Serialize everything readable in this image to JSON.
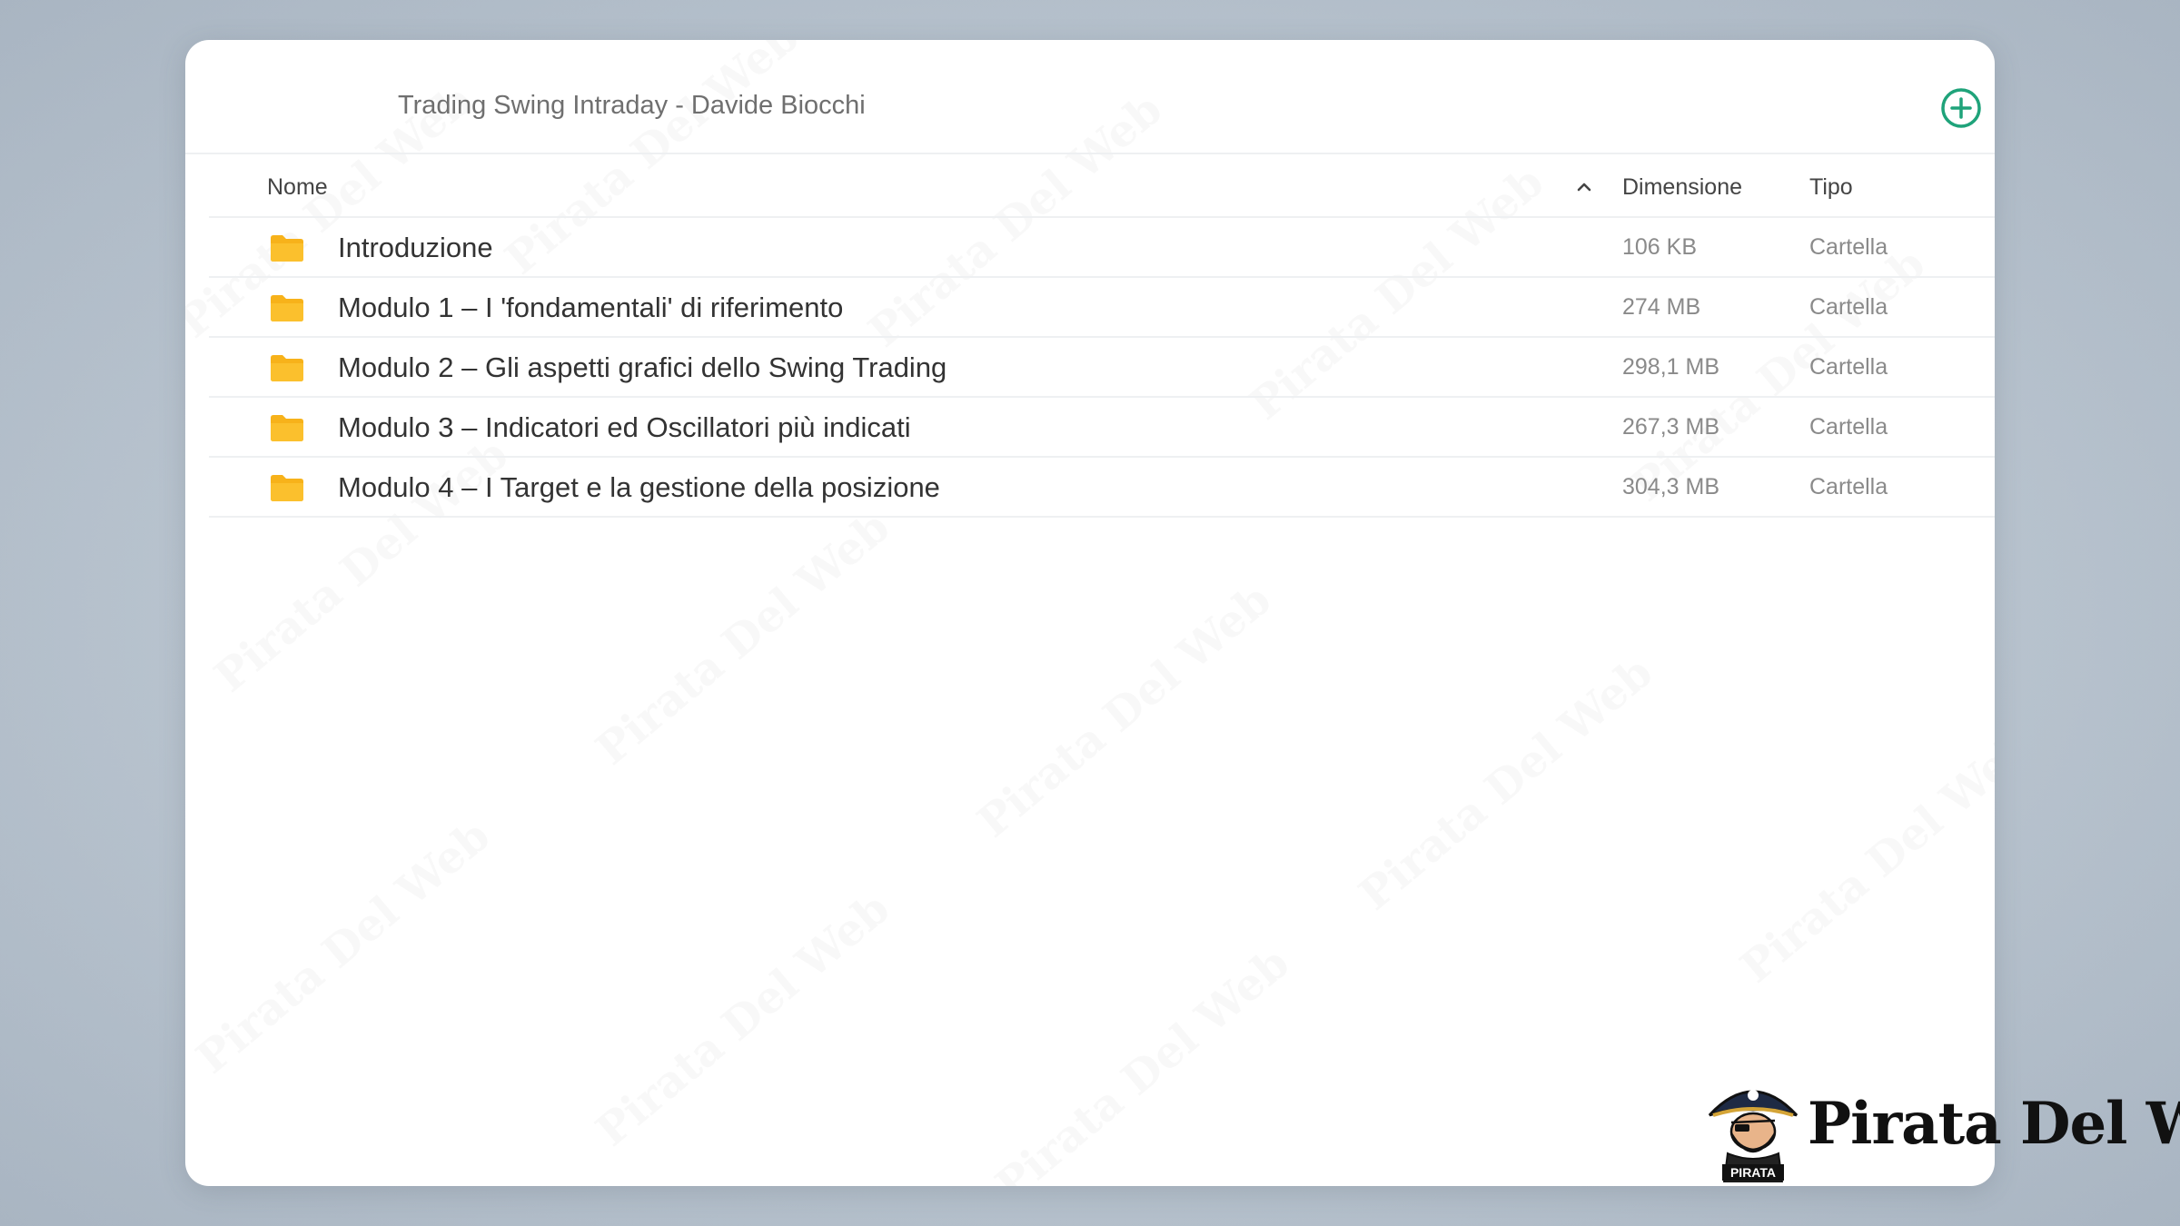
{
  "window": {
    "title": "Trading Swing Intraday - Davide Biocchi",
    "add_icon": "plus-circle-icon",
    "accent_color": "#1fa37a"
  },
  "columns": {
    "name": "Nome",
    "size": "Dimensione",
    "type": "Tipo",
    "sort_icon": "chevron-up-icon"
  },
  "rows": [
    {
      "name": "Introduzione",
      "size": "106 KB",
      "type": "Cartella"
    },
    {
      "name": "Modulo 1 – I 'fondamentali' di riferimento",
      "size": "274 MB",
      "type": "Cartella"
    },
    {
      "name": "Modulo 2 – Gli aspetti grafici dello Swing Trading",
      "size": "298,1 MB",
      "type": "Cartella"
    },
    {
      "name": "Modulo 3 – Indicatori ed Oscillatori più indicati",
      "size": "267,3 MB",
      "type": "Cartella"
    },
    {
      "name": "Modulo 4 – I Target e la gestione della posizione",
      "size": "304,3 MB",
      "type": "Cartella"
    }
  ],
  "folder_icon": "folder-icon",
  "folder_color": "#f7b21a",
  "watermark_text": "Pirata Del Web",
  "brand": {
    "name": "Pirata Del Web",
    "badge": "PIRATA"
  }
}
